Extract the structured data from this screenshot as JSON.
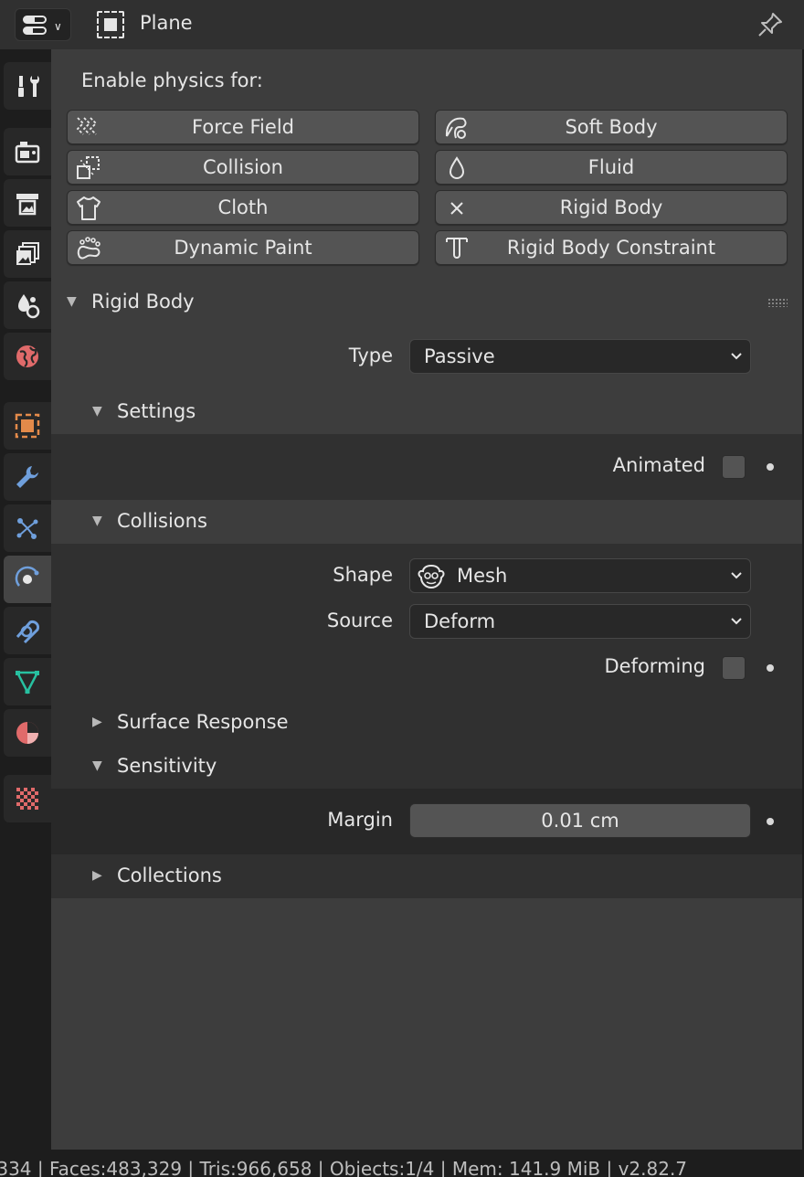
{
  "header": {
    "object_name": "Plane",
    "icons": {
      "editor_type": "properties-editor-icon",
      "object": "object-icon",
      "pin": "pin-icon"
    }
  },
  "tabs": [
    {
      "name": "tool",
      "icon": "tool-icon"
    },
    {
      "name": "render",
      "icon": "render-icon"
    },
    {
      "name": "output",
      "icon": "output-icon"
    },
    {
      "name": "view-layer",
      "icon": "view-layer-icon"
    },
    {
      "name": "scene",
      "icon": "scene-icon"
    },
    {
      "name": "world",
      "icon": "world-icon"
    },
    {
      "name": "object",
      "icon": "object-icon"
    },
    {
      "name": "modifiers",
      "icon": "wrench-icon"
    },
    {
      "name": "particles",
      "icon": "particles-icon"
    },
    {
      "name": "physics",
      "icon": "physics-icon",
      "active": true
    },
    {
      "name": "constraints",
      "icon": "constraints-icon"
    },
    {
      "name": "data",
      "icon": "mesh-data-icon"
    },
    {
      "name": "material",
      "icon": "material-icon"
    },
    {
      "name": "texture",
      "icon": "texture-icon"
    }
  ],
  "physics": {
    "enable_label": "Enable physics for:",
    "buttons": {
      "force_field": "Force Field",
      "soft_body": "Soft Body",
      "collision": "Collision",
      "fluid": "Fluid",
      "cloth": "Cloth",
      "rigid_body": "Rigid Body",
      "dynamic_paint": "Dynamic Paint",
      "rigid_body_constraint": "Rigid Body Constraint"
    }
  },
  "rigid_body": {
    "title": "Rigid Body",
    "type_label": "Type",
    "type_value": "Passive",
    "settings": {
      "title": "Settings",
      "animated_label": "Animated",
      "animated_checked": false
    },
    "collisions": {
      "title": "Collisions",
      "shape_label": "Shape",
      "shape_value": "Mesh",
      "source_label": "Source",
      "source_value": "Deform",
      "deforming_label": "Deforming",
      "deforming_checked": false
    },
    "surface_response": {
      "title": "Surface Response"
    },
    "sensitivity": {
      "title": "Sensitivity",
      "margin_label": "Margin",
      "margin_value": "0.01 cm"
    },
    "collections": {
      "title": "Collections"
    }
  },
  "status_bar": {
    "text": ",334 | Faces:483,329 | Tris:966,658 | Objects:1/4 | Mem: 141.9 MiB | v2.82.7"
  },
  "colors": {
    "panel_bg": "#3d3d3d",
    "button_bg": "#545454",
    "field_bg": "#282828",
    "active_tab": "#454545",
    "physics_blue": "#6f9fdc",
    "object_orange": "#e38a4a",
    "mesh_green": "#27c0a0",
    "material_red": "#e06a6a"
  }
}
